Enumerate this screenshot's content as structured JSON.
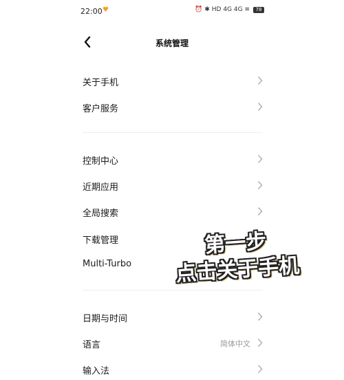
{
  "status_bar": {
    "time": "22:00",
    "icons_text": "⏰ ✱ HD 4G 4G ≋",
    "battery": "78"
  },
  "header": {
    "title": "系统管理"
  },
  "sections": [
    {
      "items": [
        {
          "label": "关于手机"
        },
        {
          "label": "客户服务"
        }
      ]
    },
    {
      "items": [
        {
          "label": "控制中心"
        },
        {
          "label": "近期应用"
        },
        {
          "label": "全局搜索"
        },
        {
          "label": "下载管理"
        },
        {
          "label": "Multi-Turbo"
        }
      ]
    },
    {
      "items": [
        {
          "label": "日期与时间"
        },
        {
          "label": "语言",
          "value": "简体中文"
        },
        {
          "label": "输入法"
        }
      ]
    }
  ],
  "overlay": {
    "line1": "第一步",
    "line2": "点击关于手机"
  },
  "colors": {
    "accent_flag": "#f0a020",
    "chevron": "#b0b0b0"
  }
}
